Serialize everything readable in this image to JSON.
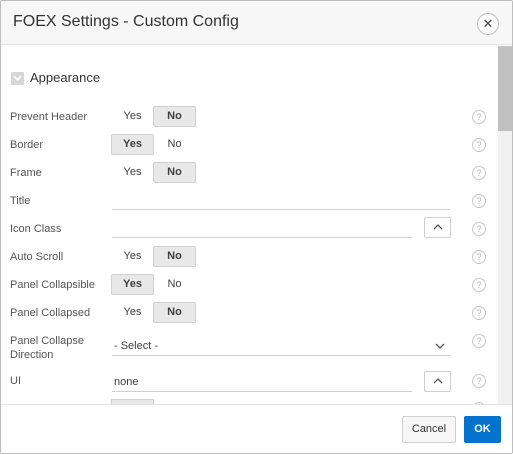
{
  "dialog": {
    "title": "FOEX Settings - Custom Config",
    "close_icon": "close-icon"
  },
  "section": {
    "title": "Appearance",
    "toggle_icon": "chevron-down-icon"
  },
  "fields": {
    "prevent_header": {
      "label": "Prevent Header",
      "yes": "Yes",
      "no": "No",
      "selected": "No"
    },
    "border": {
      "label": "Border",
      "yes": "Yes",
      "no": "No",
      "selected": "Yes"
    },
    "frame": {
      "label": "Frame",
      "yes": "Yes",
      "no": "No",
      "selected": "No"
    },
    "title": {
      "label": "Title",
      "value": ""
    },
    "icon_class": {
      "label": "Icon Class",
      "value": "",
      "picker_icon": "chevron-up-icon"
    },
    "auto_scroll": {
      "label": "Auto Scroll",
      "yes": "Yes",
      "no": "No",
      "selected": "No"
    },
    "panel_collapsible": {
      "label": "Panel Collapsible",
      "yes": "Yes",
      "no": "No",
      "selected": "Yes"
    },
    "panel_collapsed": {
      "label": "Panel Collapsed",
      "yes": "Yes",
      "no": "No",
      "selected": "No"
    },
    "panel_collapse_direction": {
      "label_line1": "Panel Collapse",
      "label_line2": "Direction",
      "value": "- Select -",
      "dropdown_icon": "chevron-down-icon"
    },
    "ui": {
      "label": "UI",
      "value": "none",
      "picker_icon": "chevron-up-icon"
    }
  },
  "help_icon": "help-icon",
  "help_glyph": "?",
  "footer": {
    "cancel_label": "Cancel",
    "ok_label": "OK"
  },
  "colors": {
    "primary": "#0572ce",
    "selected_segment": "#e8e8e8"
  }
}
